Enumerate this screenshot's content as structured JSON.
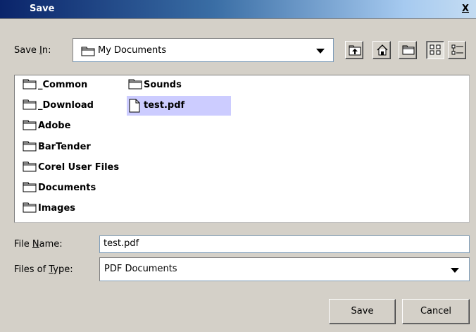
{
  "window": {
    "title": "Save",
    "close_label": "X"
  },
  "save_in": {
    "label_prefix": "Save ",
    "label_underlined": "I",
    "label_suffix": "n:",
    "value": "My Documents"
  },
  "toolbar": {
    "buttons": [
      {
        "icon": "up-folder-icon"
      },
      {
        "icon": "home-icon"
      },
      {
        "icon": "new-folder-icon"
      },
      {
        "icon": "list-view-icon",
        "pressed": true
      },
      {
        "icon": "details-view-icon"
      }
    ]
  },
  "files": {
    "col1": [
      {
        "name": "_Common",
        "kind": "folder"
      },
      {
        "name": "_Download",
        "kind": "folder"
      },
      {
        "name": "Adobe",
        "kind": "folder"
      },
      {
        "name": "BarTender",
        "kind": "folder"
      },
      {
        "name": "Corel User Files",
        "kind": "folder"
      },
      {
        "name": "Documents",
        "kind": "folder"
      },
      {
        "name": "Images",
        "kind": "folder"
      }
    ],
    "col2": [
      {
        "name": "Sounds",
        "kind": "folder"
      },
      {
        "name": "test.pdf",
        "kind": "file",
        "selected": true
      }
    ]
  },
  "file_name": {
    "label_prefix": "File ",
    "label_underlined": "N",
    "label_suffix": "ame:",
    "value": "test.pdf"
  },
  "file_type": {
    "label_prefix": "Files of ",
    "label_underlined": "T",
    "label_suffix": "ype:",
    "value": "PDF Documents"
  },
  "buttons": {
    "save_label": "Save",
    "cancel_label": "Cancel"
  },
  "colors": {
    "selection": "#ccccff",
    "dialog_bg": "#d4d0c8",
    "title_start": "#0a246a"
  }
}
